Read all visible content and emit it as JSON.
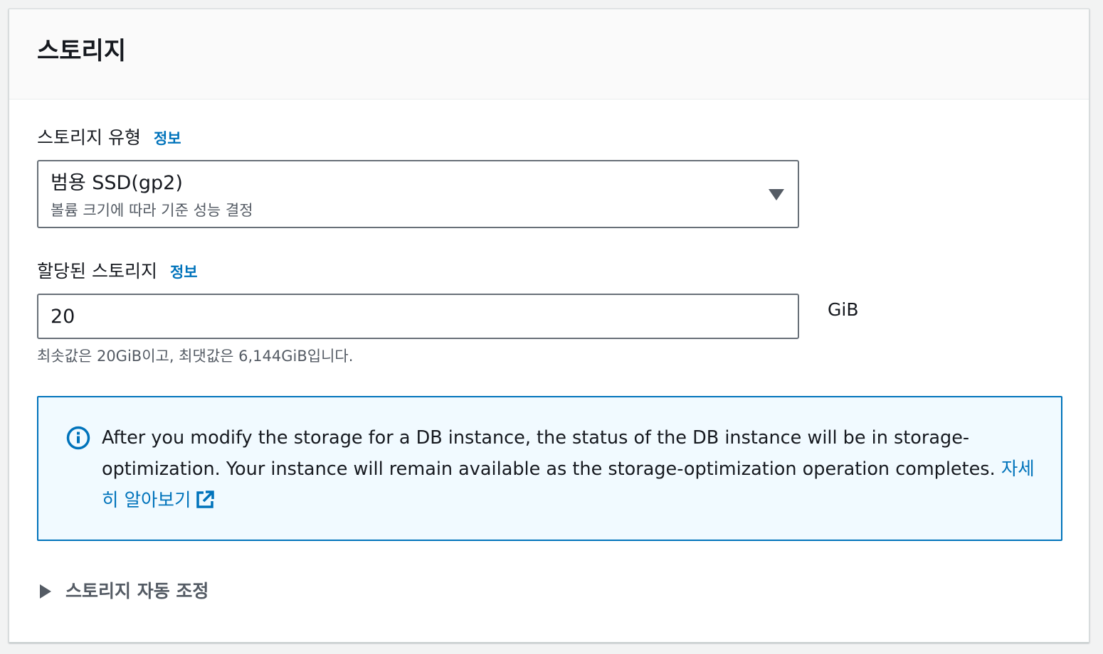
{
  "panel": {
    "title": "스토리지"
  },
  "storage_type": {
    "label": "스토리지 유형",
    "info_link": "정보",
    "selected_value": "범용 SSD(gp2)",
    "selected_description": "볼륨 크기에 따라 기준 성능 결정"
  },
  "allocated_storage": {
    "label": "할당된 스토리지",
    "info_link": "정보",
    "value": "20",
    "unit": "GiB",
    "constraint_text": "최솟값은 20GiB이고, 최댓값은 6,144GiB입니다."
  },
  "info_alert": {
    "text": "After you modify the storage for a DB instance, the status of the DB instance will be in storage-optimization. Your instance will remain available as the storage-optimization operation completes. ",
    "link_text": "자세히 알아보기",
    "icon": "info-icon",
    "link_icon": "external-link-icon"
  },
  "autoscaling": {
    "label": "스토리지 자동 조정",
    "expanded": false
  },
  "colors": {
    "link": "#0073bb",
    "alert_background": "#f1faff",
    "alert_border": "#0073bb",
    "border": "#687078",
    "secondary_text": "#545b64"
  }
}
